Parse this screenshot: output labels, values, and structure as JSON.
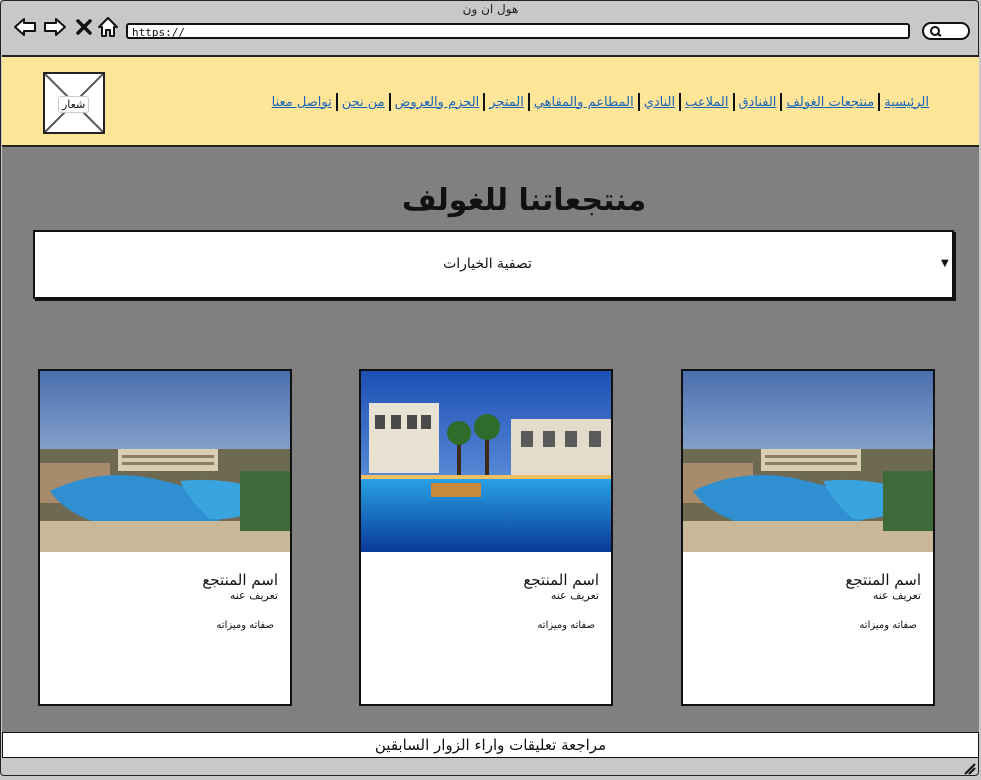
{
  "browser": {
    "title": "هول ان ون",
    "url": "https://",
    "icons": [
      "back-icon",
      "forward-icon",
      "close-icon",
      "home-icon",
      "search-icon"
    ]
  },
  "header": {
    "logo_label": "شعار",
    "nav": [
      {
        "label": "الرئيسية"
      },
      {
        "label": "منتجعات الغولف"
      },
      {
        "label": "الفنادق"
      },
      {
        "label": "الملاعب"
      },
      {
        "label": "النادي"
      },
      {
        "label": "المطاعم والمقاهي"
      },
      {
        "label": "المتجر"
      },
      {
        "label": "الحزم والعروض"
      },
      {
        "label": "من نحن"
      },
      {
        "label": "تواصل معنا"
      }
    ],
    "background": "#ffe598",
    "link_color": "#1a63b8"
  },
  "main": {
    "title": "منتجعاتنا للغولف",
    "filter_label": "تصفية الخيارات",
    "background": "#808080",
    "cards": [
      {
        "name": "اسم المنتجع",
        "description": "تعريف عنه",
        "features": "صفاته وميزاته",
        "image": "resort-waterpark"
      },
      {
        "name": "اسم المنتجع",
        "description": "تعريف عنه",
        "features": "صفاته وميزاته",
        "image": "resort-night-pool"
      },
      {
        "name": "اسم المنتجع",
        "description": "تعريف عنه",
        "features": "صفاته وميزاته",
        "image": "resort-waterpark"
      }
    ]
  },
  "footer": {
    "text": "مراجعة تعليقات واراء الزوار السابقين"
  }
}
